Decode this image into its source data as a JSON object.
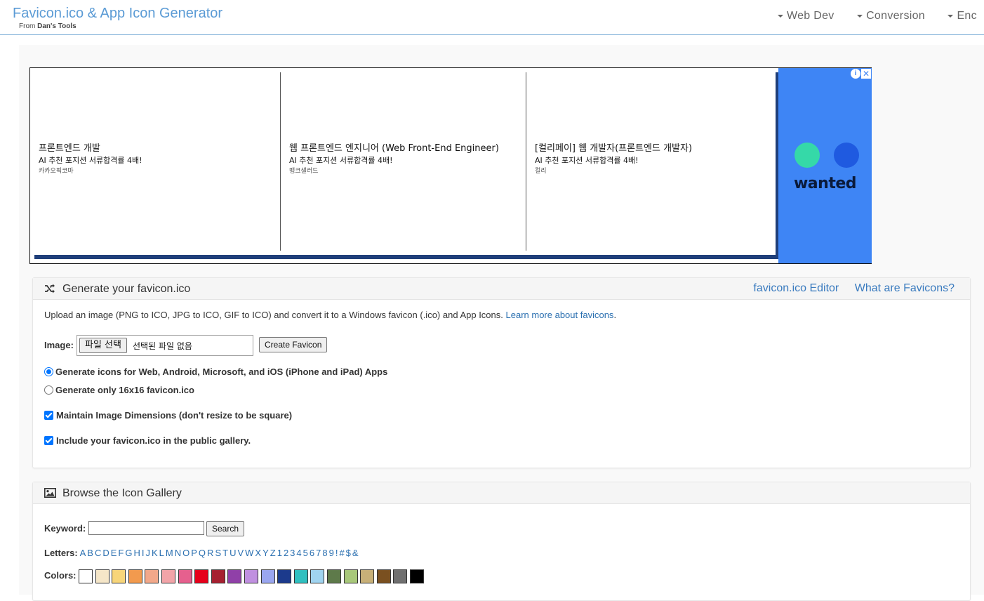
{
  "header": {
    "title": "Favicon.ico & App Icon Generator",
    "subtitle_prefix": "From ",
    "subtitle_brand": "Dan's Tools",
    "nav": [
      "Web Dev",
      "Conversion",
      "Enc"
    ]
  },
  "ad": {
    "items": [
      {
        "title": "프론트엔드 개발",
        "sub": "AI 추천 포지션 서류합격률 4배!",
        "company": "카카오픽코마"
      },
      {
        "title": "웹 프론트엔드 엔지니어 (Web Front-End Engineer)",
        "sub": "AI 추천 포지션 서류합격률 4배!",
        "company": "뱅크샐러드"
      },
      {
        "title": "[컬리페이] 웹 개발자(프론트엔드 개발자)",
        "sub": "AI 추천 포지션 서류합격률 4배!",
        "company": "컬리"
      }
    ],
    "brand": "wanted",
    "colors": {
      "bg": "#3e85f5",
      "circle_teal": "#35d9a8",
      "circle_blue": "#1f5ae0"
    }
  },
  "generate": {
    "title": "Generate your favicon.ico",
    "links": [
      "favicon.ico Editor",
      "What are Favicons?"
    ],
    "description": "Upload an image (PNG to ICO, JPG to ICO, GIF to ICO) and convert it to a Windows favicon (.ico) and App Icons. ",
    "learn_more": "Learn more about favicons",
    "learn_more_suffix": ".",
    "image_label": "Image:",
    "file_button": "파일 선택",
    "file_status": "선택된 파일 없음",
    "create_button": "Create Favicon",
    "option_all": "Generate icons for Web, Android, Microsoft, and iOS (iPhone and iPad) Apps",
    "option_16": "Generate only 16x16 favicon.ico",
    "maintain_dims": "Maintain Image Dimensions (don't resize to be square)",
    "include_gallery": "Include your favicon.ico in the public gallery."
  },
  "gallery": {
    "title": "Browse the Icon Gallery",
    "keyword_label": "Keyword:",
    "keyword_value": "",
    "search_button": "Search",
    "letters_label": "Letters:",
    "letters": [
      "A",
      "B",
      "C",
      "D",
      "E",
      "F",
      "G",
      "H",
      "I",
      "J",
      "K",
      "L",
      "M",
      "N",
      "O",
      "P",
      "Q",
      "R",
      "S",
      "T",
      "U",
      "V",
      "W",
      "X",
      "Y",
      "Z",
      "1",
      "2",
      "3",
      "4",
      "5",
      "6",
      "7",
      "8",
      "9",
      "!",
      "#",
      "$",
      "&"
    ],
    "colors_label": "Colors:",
    "colors": [
      "#ffffff",
      "#f5e6c8",
      "#f7d57a",
      "#f29a4e",
      "#f2a88a",
      "#f2a4a8",
      "#e6608e",
      "#e6001a",
      "#a62030",
      "#9040a8",
      "#c090e0",
      "#9aa6f0",
      "#1c3a8c",
      "#30c0c0",
      "#a0d4f0",
      "#5e7a4a",
      "#a8c87a",
      "#c8b078",
      "#7a5020",
      "#707070",
      "#000000"
    ]
  }
}
